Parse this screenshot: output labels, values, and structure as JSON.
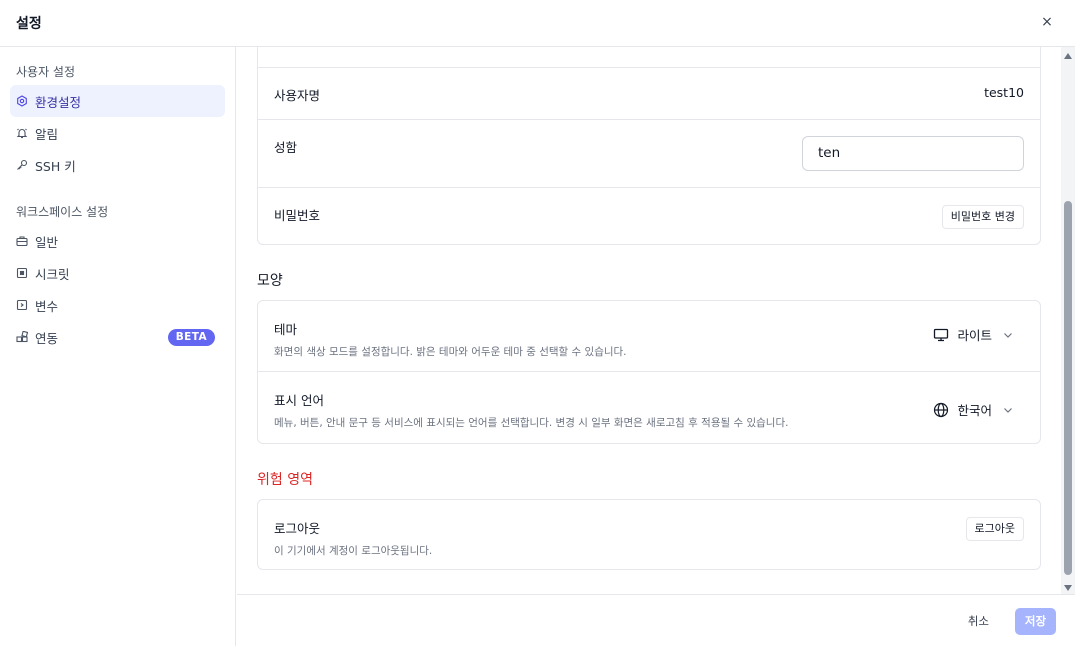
{
  "header": {
    "title": "설정",
    "close_symbol": "×"
  },
  "sidebar": {
    "user_group": "사용자 설정",
    "user_items": [
      {
        "label": "환경설정",
        "icon": "gear-icon",
        "active": true
      },
      {
        "label": "알림",
        "icon": "bell-icon"
      },
      {
        "label": "SSH 키",
        "icon": "key-icon"
      }
    ],
    "workspace_group": "워크스페이스 설정",
    "workspace_items": [
      {
        "label": "일반",
        "icon": "briefcase-icon"
      },
      {
        "label": "시크릿",
        "icon": "secret-box-icon"
      },
      {
        "label": "변수",
        "icon": "variable-box-icon"
      },
      {
        "label": "연동",
        "icon": "integration-icon",
        "badge": "BETA"
      }
    ]
  },
  "account": {
    "username_label": "사용자명",
    "username_value": "test10",
    "name_label": "성함",
    "name_value": "ten",
    "password_label": "비밀번호",
    "password_button": "비밀번호 변경"
  },
  "appearance": {
    "title": "모양",
    "theme_label": "테마",
    "theme_desc": "화면의 색상 모드를 설정합니다. 밝은 테마와 어두운 테마 중 선택할 수 있습니다.",
    "theme_value": "라이트",
    "language_label": "표시 언어",
    "language_desc": "메뉴, 버튼, 안내 문구 등 서비스에 표시되는 언어를 선택합니다. 변경 시 일부 화면은 새로고침 후 적용될 수 있습니다.",
    "language_value": "한국어"
  },
  "danger": {
    "title": "위험 영역",
    "logout_label": "로그아웃",
    "logout_desc": "이 기기에서 계정이 로그아웃됩니다.",
    "logout_button": "로그아웃"
  },
  "footer": {
    "cancel_label": "취소",
    "save_label": "저장"
  },
  "colors": {
    "accent": "#6366f1",
    "accent_soft": "#a5b4fc",
    "danger": "#dc2626",
    "active_bg": "#eef2ff"
  }
}
